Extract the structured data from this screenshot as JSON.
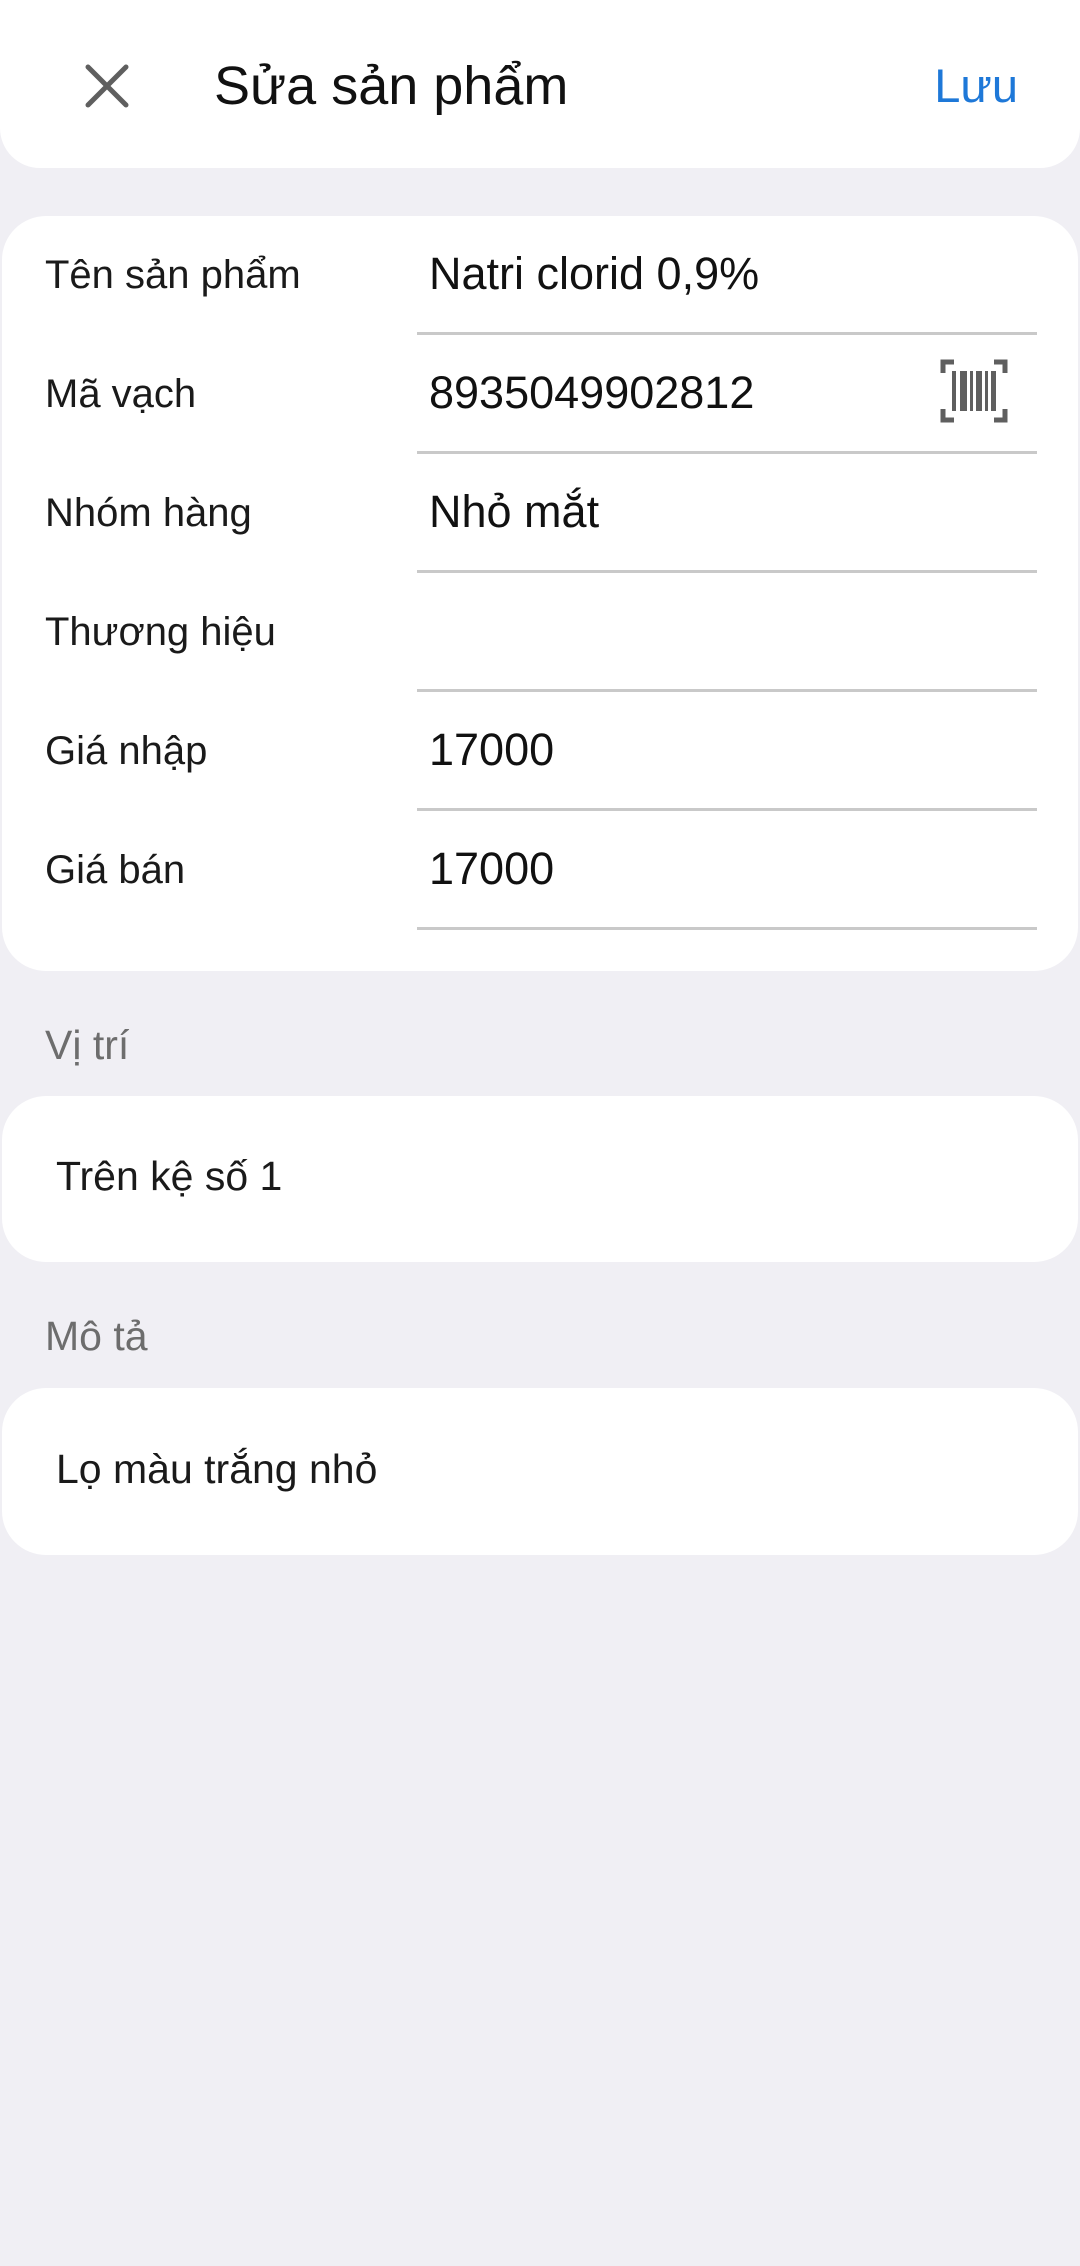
{
  "appbar": {
    "title": "Sửa sản phẩm",
    "save_label": "Lưu",
    "close_icon": "close-icon"
  },
  "form": {
    "fields": [
      {
        "label": "Tên sản phẩm",
        "value": "Natri clorid 0,9%"
      },
      {
        "label": "Mã vạch",
        "value": "8935049902812",
        "icon": "barcode-scan-icon"
      },
      {
        "label": "Nhóm hàng",
        "value": "Nhỏ mắt"
      },
      {
        "label": "Thương hiệu",
        "value": ""
      },
      {
        "label": "Giá nhập",
        "value": "17000"
      },
      {
        "label": "Giá bán",
        "value": "17000"
      }
    ]
  },
  "location": {
    "label": "Vị trí",
    "value": "Trên kệ số 1"
  },
  "description": {
    "label": "Mô tả",
    "value": "Lọ màu trắng nhỏ"
  },
  "colors": {
    "accent": "#1e78d8",
    "background": "#f0eff4",
    "card": "#ffffff",
    "divider": "#c9c9c9",
    "section_label": "#6d6d6d"
  }
}
